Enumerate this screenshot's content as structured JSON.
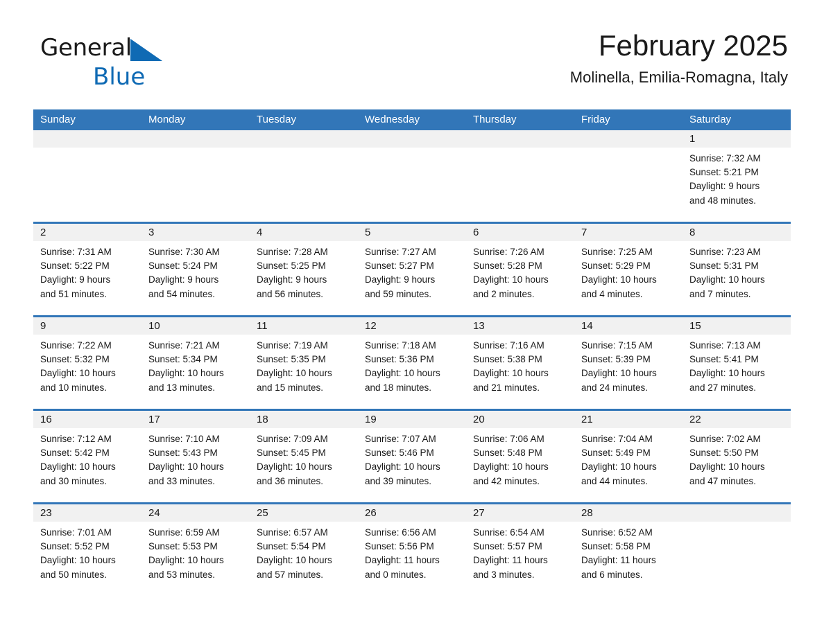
{
  "brand": {
    "name_part1": "General",
    "name_part2": "Blue",
    "triangle_color": "#0f6ab4"
  },
  "header": {
    "title": "February 2025",
    "location": "Molinella, Emilia-Romagna, Italy"
  },
  "theme": {
    "header_blue": "#3276b8",
    "row_divider_blue": "#3276b8",
    "day_band_gray": "#f1f1f1",
    "text_color": "#1a1a1a",
    "background": "#ffffff"
  },
  "weekdays": [
    "Sunday",
    "Monday",
    "Tuesday",
    "Wednesday",
    "Thursday",
    "Friday",
    "Saturday"
  ],
  "weeks": [
    [
      {
        "day": "",
        "empty": true
      },
      {
        "day": "",
        "empty": true
      },
      {
        "day": "",
        "empty": true
      },
      {
        "day": "",
        "empty": true
      },
      {
        "day": "",
        "empty": true
      },
      {
        "day": "",
        "empty": true
      },
      {
        "day": "1",
        "sunrise": "Sunrise: 7:32 AM",
        "sunset": "Sunset: 5:21 PM",
        "daylight1": "Daylight: 9 hours",
        "daylight2": "and 48 minutes."
      }
    ],
    [
      {
        "day": "2",
        "sunrise": "Sunrise: 7:31 AM",
        "sunset": "Sunset: 5:22 PM",
        "daylight1": "Daylight: 9 hours",
        "daylight2": "and 51 minutes."
      },
      {
        "day": "3",
        "sunrise": "Sunrise: 7:30 AM",
        "sunset": "Sunset: 5:24 PM",
        "daylight1": "Daylight: 9 hours",
        "daylight2": "and 54 minutes."
      },
      {
        "day": "4",
        "sunrise": "Sunrise: 7:28 AM",
        "sunset": "Sunset: 5:25 PM",
        "daylight1": "Daylight: 9 hours",
        "daylight2": "and 56 minutes."
      },
      {
        "day": "5",
        "sunrise": "Sunrise: 7:27 AM",
        "sunset": "Sunset: 5:27 PM",
        "daylight1": "Daylight: 9 hours",
        "daylight2": "and 59 minutes."
      },
      {
        "day": "6",
        "sunrise": "Sunrise: 7:26 AM",
        "sunset": "Sunset: 5:28 PM",
        "daylight1": "Daylight: 10 hours",
        "daylight2": "and 2 minutes."
      },
      {
        "day": "7",
        "sunrise": "Sunrise: 7:25 AM",
        "sunset": "Sunset: 5:29 PM",
        "daylight1": "Daylight: 10 hours",
        "daylight2": "and 4 minutes."
      },
      {
        "day": "8",
        "sunrise": "Sunrise: 7:23 AM",
        "sunset": "Sunset: 5:31 PM",
        "daylight1": "Daylight: 10 hours",
        "daylight2": "and 7 minutes."
      }
    ],
    [
      {
        "day": "9",
        "sunrise": "Sunrise: 7:22 AM",
        "sunset": "Sunset: 5:32 PM",
        "daylight1": "Daylight: 10 hours",
        "daylight2": "and 10 minutes."
      },
      {
        "day": "10",
        "sunrise": "Sunrise: 7:21 AM",
        "sunset": "Sunset: 5:34 PM",
        "daylight1": "Daylight: 10 hours",
        "daylight2": "and 13 minutes."
      },
      {
        "day": "11",
        "sunrise": "Sunrise: 7:19 AM",
        "sunset": "Sunset: 5:35 PM",
        "daylight1": "Daylight: 10 hours",
        "daylight2": "and 15 minutes."
      },
      {
        "day": "12",
        "sunrise": "Sunrise: 7:18 AM",
        "sunset": "Sunset: 5:36 PM",
        "daylight1": "Daylight: 10 hours",
        "daylight2": "and 18 minutes."
      },
      {
        "day": "13",
        "sunrise": "Sunrise: 7:16 AM",
        "sunset": "Sunset: 5:38 PM",
        "daylight1": "Daylight: 10 hours",
        "daylight2": "and 21 minutes."
      },
      {
        "day": "14",
        "sunrise": "Sunrise: 7:15 AM",
        "sunset": "Sunset: 5:39 PM",
        "daylight1": "Daylight: 10 hours",
        "daylight2": "and 24 minutes."
      },
      {
        "day": "15",
        "sunrise": "Sunrise: 7:13 AM",
        "sunset": "Sunset: 5:41 PM",
        "daylight1": "Daylight: 10 hours",
        "daylight2": "and 27 minutes."
      }
    ],
    [
      {
        "day": "16",
        "sunrise": "Sunrise: 7:12 AM",
        "sunset": "Sunset: 5:42 PM",
        "daylight1": "Daylight: 10 hours",
        "daylight2": "and 30 minutes."
      },
      {
        "day": "17",
        "sunrise": "Sunrise: 7:10 AM",
        "sunset": "Sunset: 5:43 PM",
        "daylight1": "Daylight: 10 hours",
        "daylight2": "and 33 minutes."
      },
      {
        "day": "18",
        "sunrise": "Sunrise: 7:09 AM",
        "sunset": "Sunset: 5:45 PM",
        "daylight1": "Daylight: 10 hours",
        "daylight2": "and 36 minutes."
      },
      {
        "day": "19",
        "sunrise": "Sunrise: 7:07 AM",
        "sunset": "Sunset: 5:46 PM",
        "daylight1": "Daylight: 10 hours",
        "daylight2": "and 39 minutes."
      },
      {
        "day": "20",
        "sunrise": "Sunrise: 7:06 AM",
        "sunset": "Sunset: 5:48 PM",
        "daylight1": "Daylight: 10 hours",
        "daylight2": "and 42 minutes."
      },
      {
        "day": "21",
        "sunrise": "Sunrise: 7:04 AM",
        "sunset": "Sunset: 5:49 PM",
        "daylight1": "Daylight: 10 hours",
        "daylight2": "and 44 minutes."
      },
      {
        "day": "22",
        "sunrise": "Sunrise: 7:02 AM",
        "sunset": "Sunset: 5:50 PM",
        "daylight1": "Daylight: 10 hours",
        "daylight2": "and 47 minutes."
      }
    ],
    [
      {
        "day": "23",
        "sunrise": "Sunrise: 7:01 AM",
        "sunset": "Sunset: 5:52 PM",
        "daylight1": "Daylight: 10 hours",
        "daylight2": "and 50 minutes."
      },
      {
        "day": "24",
        "sunrise": "Sunrise: 6:59 AM",
        "sunset": "Sunset: 5:53 PM",
        "daylight1": "Daylight: 10 hours",
        "daylight2": "and 53 minutes."
      },
      {
        "day": "25",
        "sunrise": "Sunrise: 6:57 AM",
        "sunset": "Sunset: 5:54 PM",
        "daylight1": "Daylight: 10 hours",
        "daylight2": "and 57 minutes."
      },
      {
        "day": "26",
        "sunrise": "Sunrise: 6:56 AM",
        "sunset": "Sunset: 5:56 PM",
        "daylight1": "Daylight: 11 hours",
        "daylight2": "and 0 minutes."
      },
      {
        "day": "27",
        "sunrise": "Sunrise: 6:54 AM",
        "sunset": "Sunset: 5:57 PM",
        "daylight1": "Daylight: 11 hours",
        "daylight2": "and 3 minutes."
      },
      {
        "day": "28",
        "sunrise": "Sunrise: 6:52 AM",
        "sunset": "Sunset: 5:58 PM",
        "daylight1": "Daylight: 11 hours",
        "daylight2": "and 6 minutes."
      },
      {
        "day": "",
        "empty": true
      }
    ]
  ]
}
